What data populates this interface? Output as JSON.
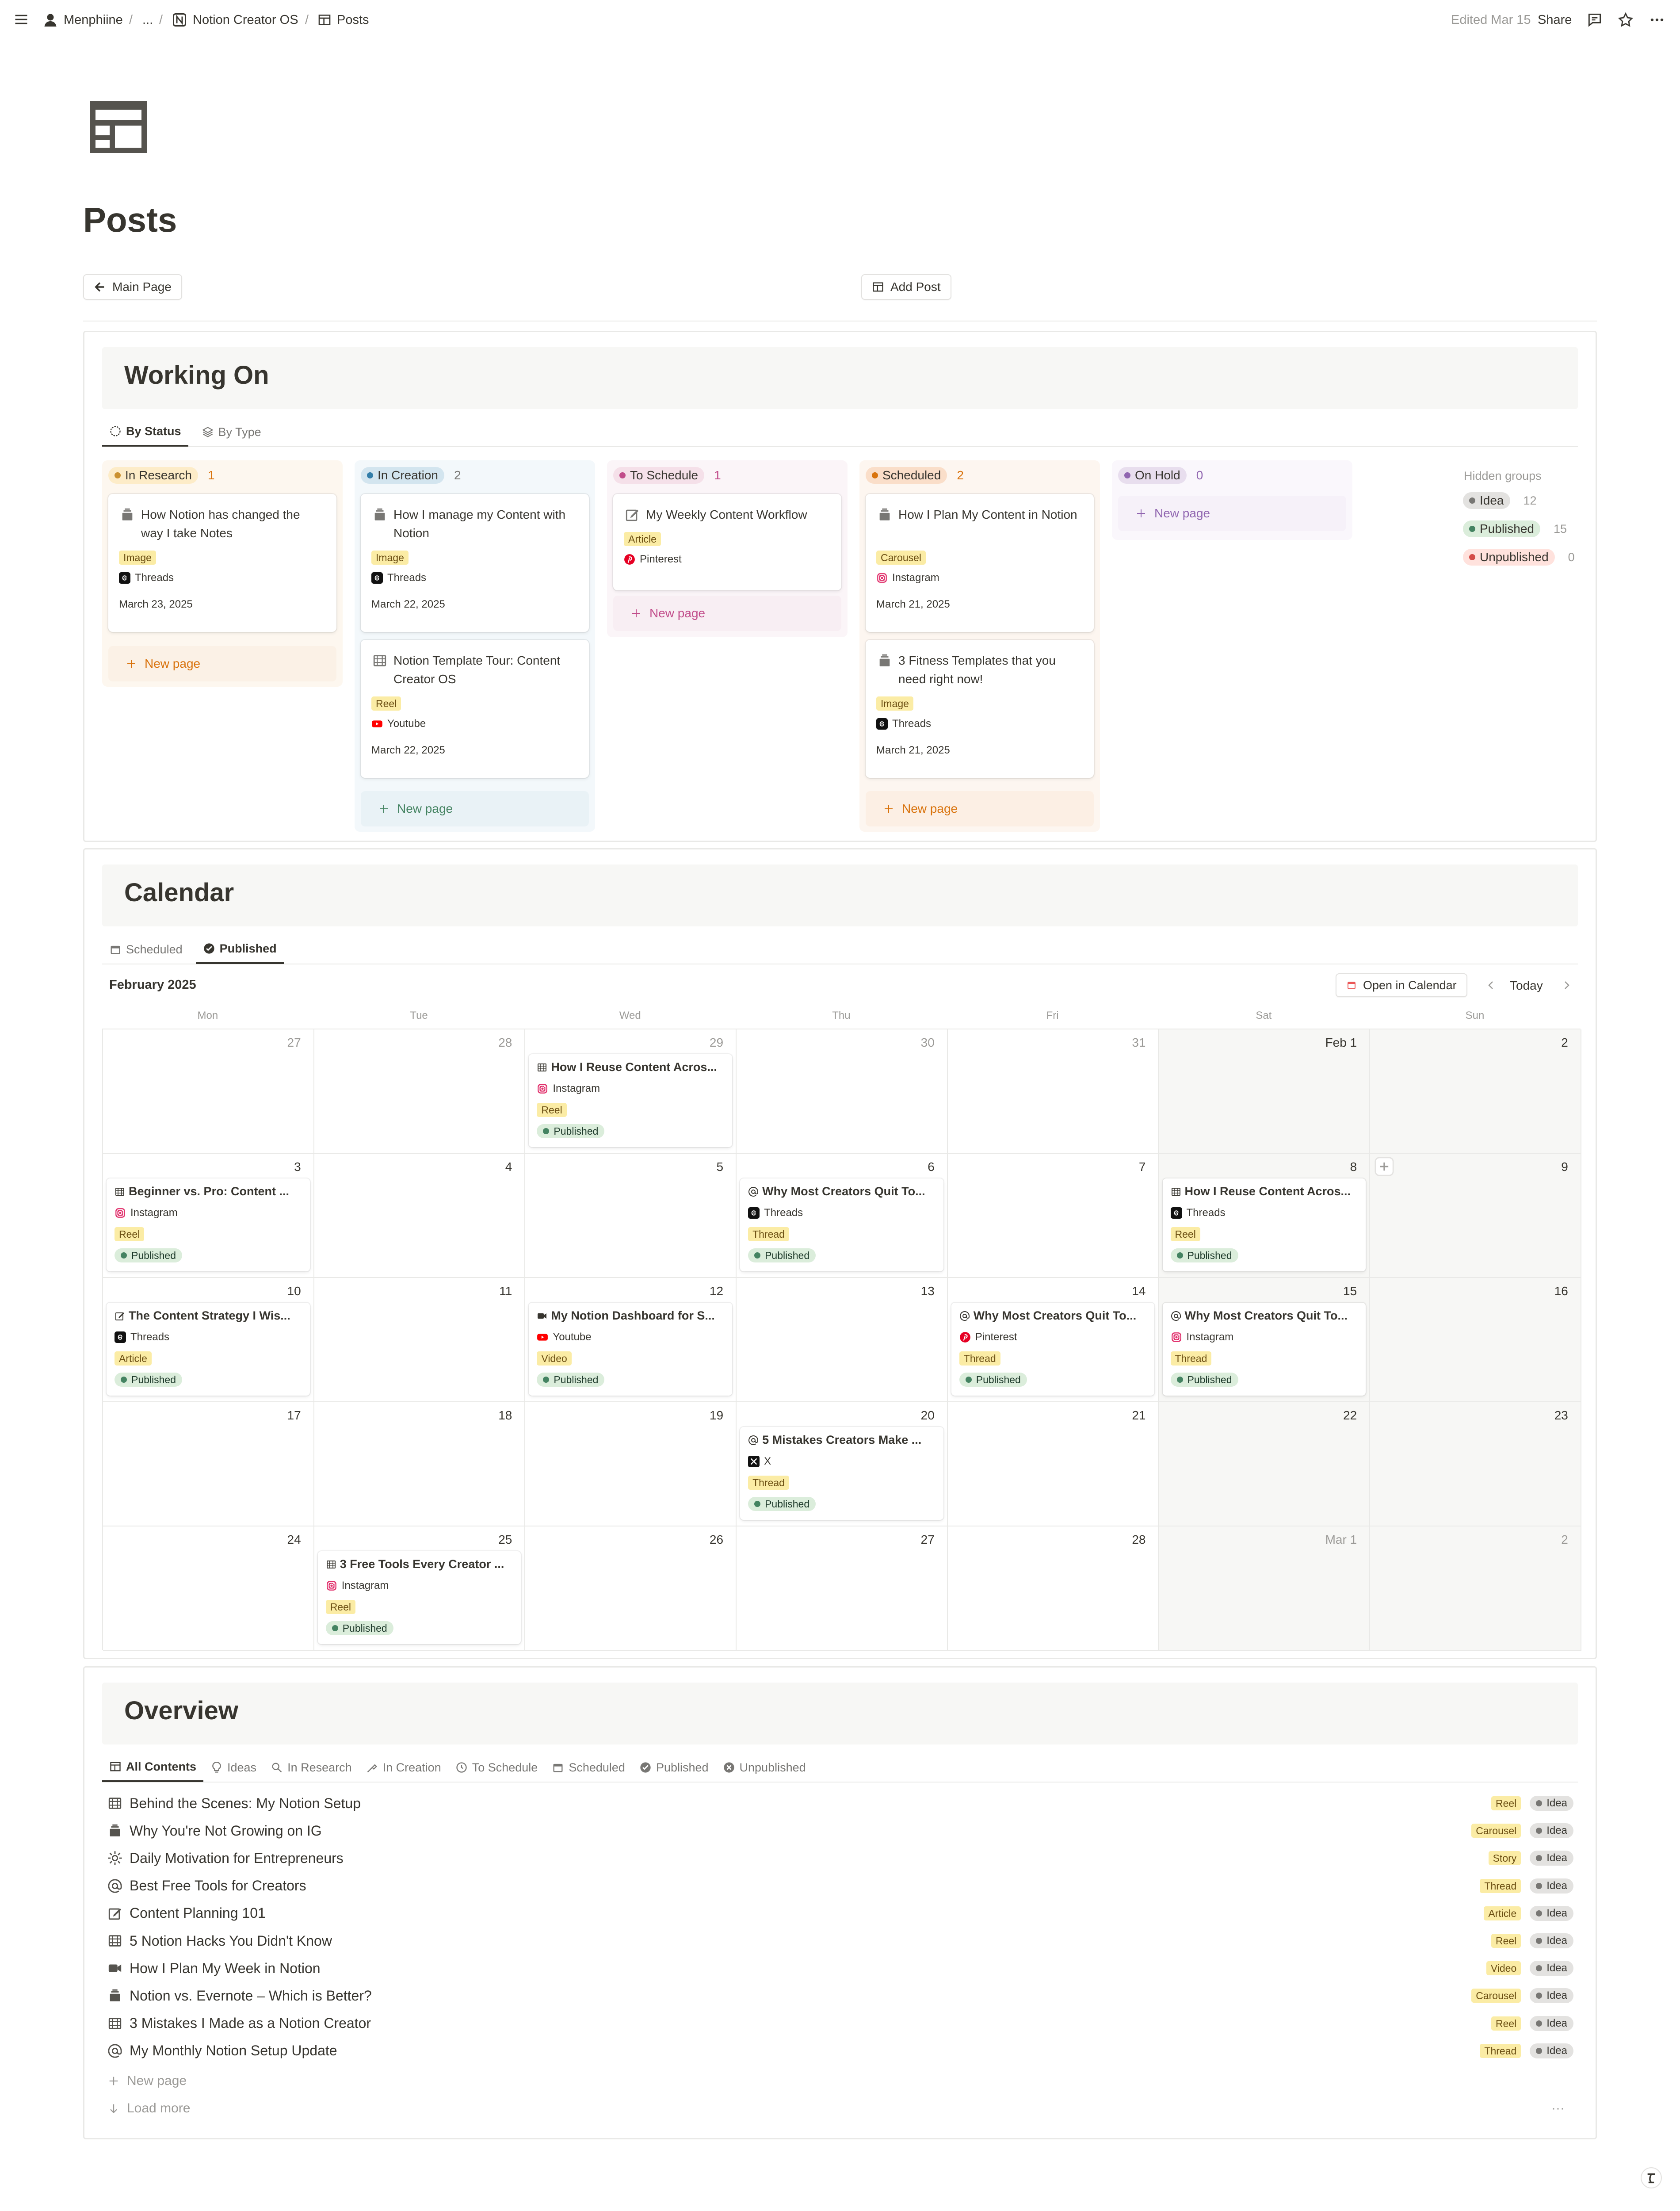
{
  "topbar": {
    "breadcrumbs": [
      "Menphiine",
      "...",
      "Notion Creator OS",
      "Posts"
    ],
    "edited": "Edited Mar 15",
    "share": "Share"
  },
  "page": {
    "title": "Posts",
    "main_page_btn": "Main Page",
    "add_post_btn": "Add Post"
  },
  "working_on": {
    "title": "Working On",
    "tabs": [
      "By Status",
      "By Type"
    ],
    "columns": [
      {
        "name": "In Research",
        "count": "1",
        "color": "#fdecc8",
        "bg": "#fdf7ef",
        "dot": "#cb912f",
        "count_color": "#d9730d",
        "cards": [
          {
            "title": "How Notion has changed the way I take Notes",
            "type": "Image",
            "platform": "Threads",
            "date": "March 23, 2025"
          }
        ],
        "new_page": "New page",
        "new_color": "#d9730d",
        "new_bg": "#fbf1e6"
      },
      {
        "name": "In Creation",
        "count": "2",
        "color": "#d3e5ef",
        "bg": "#f3f8fb",
        "dot": "#337ea9",
        "count_color": "#787774",
        "cards": [
          {
            "title": "How I manage my Content with Notion",
            "type": "Image",
            "platform": "Threads",
            "date": "March 22, 2025"
          },
          {
            "title": "Notion Template Tour: Content Creator OS",
            "type": "Reel",
            "platform": "Youtube",
            "date": "March 22, 2025"
          }
        ],
        "new_page": "New page",
        "new_color": "#448361",
        "new_bg": "#e9f2f6"
      },
      {
        "name": "To Schedule",
        "count": "1",
        "color": "#f5e0e9",
        "bg": "#fbf5f8",
        "dot": "#c14c8a",
        "count_color": "#c14c8a",
        "cards": [
          {
            "title": "My Weekly Content Workflow",
            "type": "Article",
            "platform": "Pinterest",
            "date": ""
          }
        ],
        "new_page": "New page",
        "new_color": "#c14c8a",
        "new_bg": "#f8eef3"
      },
      {
        "name": "Scheduled",
        "count": "2",
        "color": "#fadec9",
        "bg": "#fdf6f0",
        "dot": "#d9730d",
        "count_color": "#d9730d",
        "cards": [
          {
            "title": "How I Plan My Content in Notion",
            "type": "Carousel",
            "platform": "Instagram",
            "date": "March 21, 2025"
          },
          {
            "title": "3 Fitness Templates that you need right now!",
            "type": "Image",
            "platform": "Threads",
            "date": "March 21, 2025"
          }
        ],
        "new_page": "New page",
        "new_color": "#d9730d",
        "new_bg": "#fcefe4"
      },
      {
        "name": "On Hold",
        "count": "0",
        "color": "#e8deee",
        "bg": "#faf7fc",
        "dot": "#9065b0",
        "count_color": "#9065b0",
        "cards": [],
        "new_page": "New page",
        "new_color": "#9065b0",
        "new_bg": "#f6f1f9"
      }
    ],
    "hidden_groups_label": "Hidden groups",
    "hidden_groups": [
      {
        "name": "Idea",
        "count": "12",
        "bg": "#e3e2e0",
        "dot": "#787774"
      },
      {
        "name": "Published",
        "count": "15",
        "bg": "#dbeddb",
        "dot": "#448361"
      },
      {
        "name": "Unpublished",
        "count": "0",
        "bg": "#ffe2dd",
        "dot": "#d44c47"
      }
    ]
  },
  "calendar": {
    "title": "Calendar",
    "tabs": [
      "Scheduled",
      "Published"
    ],
    "month": "February 2025",
    "open_btn": "Open in Calendar",
    "today": "Today",
    "days": [
      "Mon",
      "Tue",
      "Wed",
      "Thu",
      "Fri",
      "Sat",
      "Sun"
    ],
    "weeks": [
      [
        "27",
        "28",
        "29",
        "30",
        "31",
        "Feb 1",
        "2"
      ],
      [
        "3",
        "4",
        "5",
        "6",
        "7",
        "8",
        "9"
      ],
      [
        "10",
        "11",
        "12",
        "13",
        "14",
        "15",
        "16"
      ],
      [
        "17",
        "18",
        "19",
        "20",
        "21",
        "22",
        "23"
      ],
      [
        "24",
        "25",
        "26",
        "27",
        "28",
        "Mar 1",
        "2"
      ]
    ],
    "events": [
      {
        "week": 0,
        "day": 2,
        "icon": "film",
        "title": "How I Reuse Content Acros...",
        "platform": "Instagram",
        "type": "Reel",
        "status": "Published"
      },
      {
        "week": 1,
        "day": 0,
        "icon": "film",
        "title": "Beginner vs. Pro: Content ...",
        "platform": "Instagram",
        "type": "Reel",
        "status": "Published"
      },
      {
        "week": 1,
        "day": 3,
        "icon": "at",
        "title": "Why Most Creators Quit To...",
        "platform": "Threads",
        "type": "Thread",
        "status": "Published"
      },
      {
        "week": 1,
        "day": 5,
        "icon": "film",
        "title": "How I Reuse Content Acros...",
        "platform": "Threads",
        "type": "Reel",
        "status": "Published"
      },
      {
        "week": 2,
        "day": 0,
        "icon": "pen",
        "title": "The Content Strategy I Wis...",
        "platform": "Threads",
        "type": "Article",
        "status": "Published"
      },
      {
        "week": 2,
        "day": 2,
        "icon": "video",
        "title": "My Notion Dashboard for S...",
        "platform": "Youtube",
        "type": "Video",
        "status": "Published"
      },
      {
        "week": 2,
        "day": 4,
        "icon": "at",
        "title": "Why Most Creators Quit To...",
        "platform": "Pinterest",
        "type": "Thread",
        "status": "Published"
      },
      {
        "week": 2,
        "day": 5,
        "icon": "at",
        "title": "Why Most Creators Quit To...",
        "platform": "Instagram",
        "type": "Thread",
        "status": "Published"
      },
      {
        "week": 3,
        "day": 3,
        "icon": "at",
        "title": "5 Mistakes Creators Make ...",
        "platform": "X",
        "type": "Thread",
        "status": "Published"
      },
      {
        "week": 4,
        "day": 1,
        "icon": "film",
        "title": "3 Free Tools Every Creator ...",
        "platform": "Instagram",
        "type": "Reel",
        "status": "Published"
      }
    ]
  },
  "overview": {
    "title": "Overview",
    "tabs": [
      "All Contents",
      "Ideas",
      "In Research",
      "In Creation",
      "To Schedule",
      "Scheduled",
      "Published",
      "Unpublished"
    ],
    "rows": [
      {
        "icon": "film",
        "title": "Behind the Scenes: My Notion Setup",
        "type": "Reel",
        "status": "Idea"
      },
      {
        "icon": "stack",
        "title": "Why You're Not Growing on IG",
        "type": "Carousel",
        "status": "Idea"
      },
      {
        "icon": "sun",
        "title": "Daily Motivation for Entrepreneurs",
        "type": "Story",
        "status": "Idea"
      },
      {
        "icon": "at",
        "title": "Best Free Tools for Creators",
        "type": "Thread",
        "status": "Idea"
      },
      {
        "icon": "pen",
        "title": "Content Planning 101",
        "type": "Article",
        "status": "Idea"
      },
      {
        "icon": "film",
        "title": "5 Notion Hacks You Didn't Know",
        "type": "Reel",
        "status": "Idea"
      },
      {
        "icon": "video",
        "title": "How I Plan My Week in Notion",
        "type": "Video",
        "status": "Idea"
      },
      {
        "icon": "stack",
        "title": "Notion vs. Evernote – Which is Better?",
        "type": "Carousel",
        "status": "Idea"
      },
      {
        "icon": "film",
        "title": "3 Mistakes I Made as a Notion Creator",
        "type": "Reel",
        "status": "Idea"
      },
      {
        "icon": "at",
        "title": "My Monthly Notion Setup Update",
        "type": "Thread",
        "status": "Idea"
      }
    ],
    "new_page": "New page",
    "load_more": "Load more",
    "more": "···"
  }
}
